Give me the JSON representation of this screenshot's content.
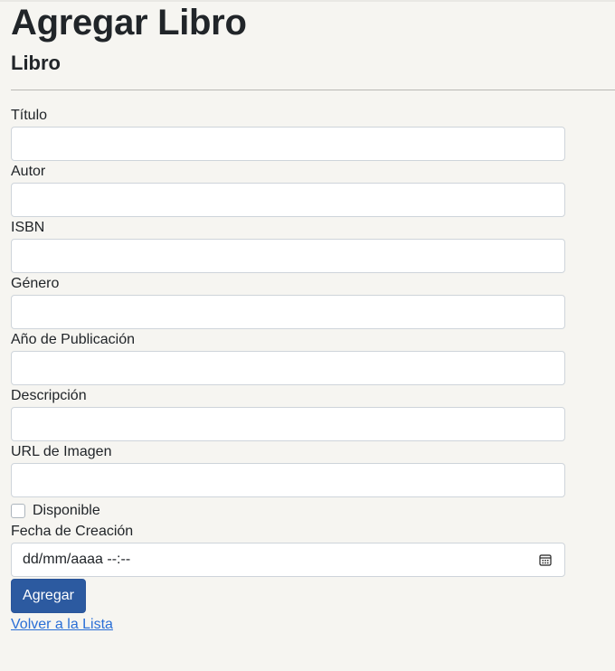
{
  "header": {
    "title": "Agregar Libro",
    "subtitle": "Libro"
  },
  "form": {
    "fields": [
      {
        "label": "Título",
        "value": ""
      },
      {
        "label": "Autor",
        "value": ""
      },
      {
        "label": "ISBN",
        "value": ""
      },
      {
        "label": "Género",
        "value": ""
      },
      {
        "label": "Año de Publicación",
        "value": ""
      },
      {
        "label": "Descripción",
        "value": ""
      },
      {
        "label": "URL de Imagen",
        "value": ""
      }
    ],
    "disponible_label": "Disponible",
    "disponible_checked": false,
    "fecha_label": "Fecha de Creación",
    "fecha_placeholder": "dd/mm/aaaa --:--",
    "submit_label": "Agregar",
    "back_link_label": "Volver a la Lista"
  },
  "icons": {
    "calendar": "calendar-icon"
  },
  "colors": {
    "background": "#f6f5f1",
    "button": "#2c5aa0",
    "link": "#2a6fd6"
  }
}
